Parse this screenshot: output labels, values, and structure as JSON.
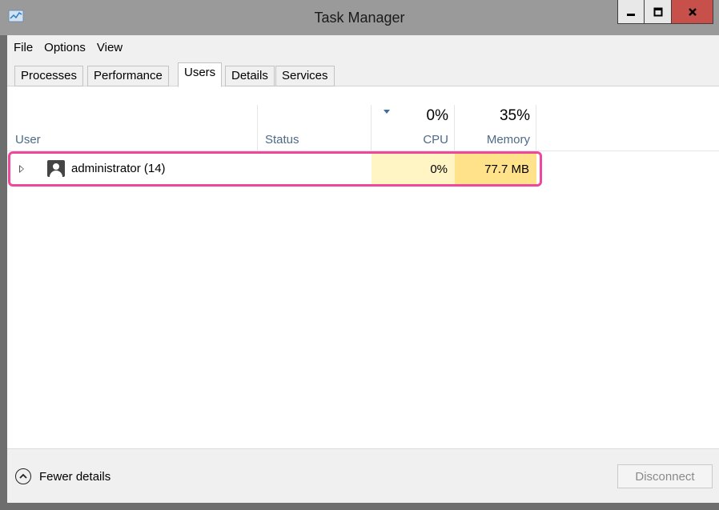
{
  "window": {
    "title": "Task Manager",
    "icon": "task-manager-icon"
  },
  "menu": {
    "items": [
      "File",
      "Options",
      "View"
    ]
  },
  "tabs": [
    {
      "label": "Processes",
      "active": false
    },
    {
      "label": "Performance",
      "active": false
    },
    {
      "label": "Users",
      "active": true
    },
    {
      "label": "Details",
      "active": false
    },
    {
      "label": "Services",
      "active": false
    }
  ],
  "columns": {
    "user": "User",
    "status": "Status",
    "cpu": {
      "label": "CPU",
      "percent": "0%",
      "sorted": true
    },
    "memory": {
      "label": "Memory",
      "percent": "35%"
    }
  },
  "rows": [
    {
      "name": "administrator (14)",
      "status": "",
      "cpu": "0%",
      "memory": "77.7 MB",
      "icon": "user-icon",
      "expanded": false
    }
  ],
  "colors": {
    "highlight_border": "#f0479a",
    "cpu_cell": "#fff4c4",
    "memory_cell": "#ffe28a",
    "column_label": "#4d6a87",
    "close_button": "#c7504a"
  },
  "footer": {
    "fewer_details": "Fewer details",
    "disconnect": "Disconnect",
    "disconnect_enabled": false
  }
}
